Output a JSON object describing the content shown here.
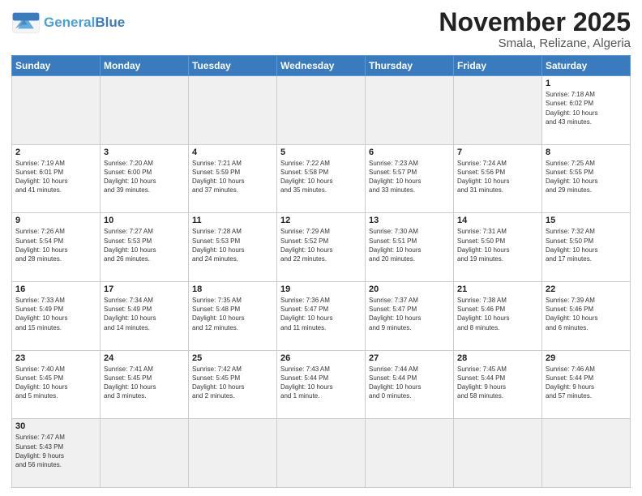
{
  "header": {
    "logo_general": "General",
    "logo_blue": "Blue",
    "month_title": "November 2025",
    "subtitle": "Smala, Relizane, Algeria"
  },
  "days_of_week": [
    "Sunday",
    "Monday",
    "Tuesday",
    "Wednesday",
    "Thursday",
    "Friday",
    "Saturday"
  ],
  "weeks": [
    [
      {
        "day": "",
        "info": ""
      },
      {
        "day": "",
        "info": ""
      },
      {
        "day": "",
        "info": ""
      },
      {
        "day": "",
        "info": ""
      },
      {
        "day": "",
        "info": ""
      },
      {
        "day": "",
        "info": ""
      },
      {
        "day": "1",
        "info": "Sunrise: 7:18 AM\nSunset: 6:02 PM\nDaylight: 10 hours\nand 43 minutes."
      }
    ],
    [
      {
        "day": "2",
        "info": "Sunrise: 7:19 AM\nSunset: 6:01 PM\nDaylight: 10 hours\nand 41 minutes."
      },
      {
        "day": "3",
        "info": "Sunrise: 7:20 AM\nSunset: 6:00 PM\nDaylight: 10 hours\nand 39 minutes."
      },
      {
        "day": "4",
        "info": "Sunrise: 7:21 AM\nSunset: 5:59 PM\nDaylight: 10 hours\nand 37 minutes."
      },
      {
        "day": "5",
        "info": "Sunrise: 7:22 AM\nSunset: 5:58 PM\nDaylight: 10 hours\nand 35 minutes."
      },
      {
        "day": "6",
        "info": "Sunrise: 7:23 AM\nSunset: 5:57 PM\nDaylight: 10 hours\nand 33 minutes."
      },
      {
        "day": "7",
        "info": "Sunrise: 7:24 AM\nSunset: 5:56 PM\nDaylight: 10 hours\nand 31 minutes."
      },
      {
        "day": "8",
        "info": "Sunrise: 7:25 AM\nSunset: 5:55 PM\nDaylight: 10 hours\nand 29 minutes."
      }
    ],
    [
      {
        "day": "9",
        "info": "Sunrise: 7:26 AM\nSunset: 5:54 PM\nDaylight: 10 hours\nand 28 minutes."
      },
      {
        "day": "10",
        "info": "Sunrise: 7:27 AM\nSunset: 5:53 PM\nDaylight: 10 hours\nand 26 minutes."
      },
      {
        "day": "11",
        "info": "Sunrise: 7:28 AM\nSunset: 5:53 PM\nDaylight: 10 hours\nand 24 minutes."
      },
      {
        "day": "12",
        "info": "Sunrise: 7:29 AM\nSunset: 5:52 PM\nDaylight: 10 hours\nand 22 minutes."
      },
      {
        "day": "13",
        "info": "Sunrise: 7:30 AM\nSunset: 5:51 PM\nDaylight: 10 hours\nand 20 minutes."
      },
      {
        "day": "14",
        "info": "Sunrise: 7:31 AM\nSunset: 5:50 PM\nDaylight: 10 hours\nand 19 minutes."
      },
      {
        "day": "15",
        "info": "Sunrise: 7:32 AM\nSunset: 5:50 PM\nDaylight: 10 hours\nand 17 minutes."
      }
    ],
    [
      {
        "day": "16",
        "info": "Sunrise: 7:33 AM\nSunset: 5:49 PM\nDaylight: 10 hours\nand 15 minutes."
      },
      {
        "day": "17",
        "info": "Sunrise: 7:34 AM\nSunset: 5:49 PM\nDaylight: 10 hours\nand 14 minutes."
      },
      {
        "day": "18",
        "info": "Sunrise: 7:35 AM\nSunset: 5:48 PM\nDaylight: 10 hours\nand 12 minutes."
      },
      {
        "day": "19",
        "info": "Sunrise: 7:36 AM\nSunset: 5:47 PM\nDaylight: 10 hours\nand 11 minutes."
      },
      {
        "day": "20",
        "info": "Sunrise: 7:37 AM\nSunset: 5:47 PM\nDaylight: 10 hours\nand 9 minutes."
      },
      {
        "day": "21",
        "info": "Sunrise: 7:38 AM\nSunset: 5:46 PM\nDaylight: 10 hours\nand 8 minutes."
      },
      {
        "day": "22",
        "info": "Sunrise: 7:39 AM\nSunset: 5:46 PM\nDaylight: 10 hours\nand 6 minutes."
      }
    ],
    [
      {
        "day": "23",
        "info": "Sunrise: 7:40 AM\nSunset: 5:45 PM\nDaylight: 10 hours\nand 5 minutes."
      },
      {
        "day": "24",
        "info": "Sunrise: 7:41 AM\nSunset: 5:45 PM\nDaylight: 10 hours\nand 3 minutes."
      },
      {
        "day": "25",
        "info": "Sunrise: 7:42 AM\nSunset: 5:45 PM\nDaylight: 10 hours\nand 2 minutes."
      },
      {
        "day": "26",
        "info": "Sunrise: 7:43 AM\nSunset: 5:44 PM\nDaylight: 10 hours\nand 1 minute."
      },
      {
        "day": "27",
        "info": "Sunrise: 7:44 AM\nSunset: 5:44 PM\nDaylight: 10 hours\nand 0 minutes."
      },
      {
        "day": "28",
        "info": "Sunrise: 7:45 AM\nSunset: 5:44 PM\nDaylight: 9 hours\nand 58 minutes."
      },
      {
        "day": "29",
        "info": "Sunrise: 7:46 AM\nSunset: 5:44 PM\nDaylight: 9 hours\nand 57 minutes."
      }
    ],
    [
      {
        "day": "30",
        "info": "Sunrise: 7:47 AM\nSunset: 5:43 PM\nDaylight: 9 hours\nand 56 minutes."
      },
      {
        "day": "",
        "info": ""
      },
      {
        "day": "",
        "info": ""
      },
      {
        "day": "",
        "info": ""
      },
      {
        "day": "",
        "info": ""
      },
      {
        "day": "",
        "info": ""
      },
      {
        "day": "",
        "info": ""
      }
    ]
  ]
}
